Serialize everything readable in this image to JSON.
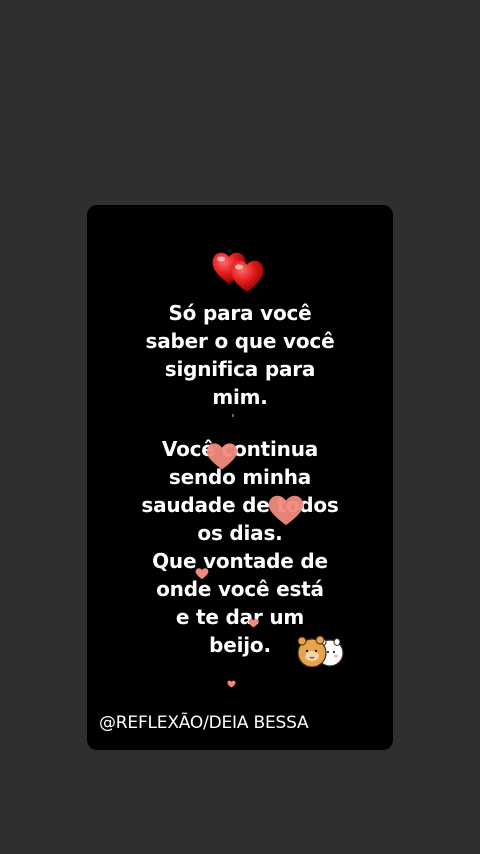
{
  "post": {
    "heart_emoji": "double-red-hearts-icon",
    "stanza1": [
      "Só para você",
      "saber o que você",
      "significa para",
      "mim."
    ],
    "stanza2": [
      "Você continua",
      "sendo minha",
      "saudade de todos",
      "os dias.",
      "Que vontade de",
      "onde você está",
      "e te dar um",
      "beijo."
    ],
    "credit": "@REFLEXÃO/DEIA BESSA",
    "sticker": "hugging-bears-sticker-icon"
  },
  "colors": {
    "background": "#302e2f",
    "card": "#000000",
    "text": "#ffffff",
    "heart_red": "#e01a1a",
    "floating_heart": "#f08b7d"
  }
}
